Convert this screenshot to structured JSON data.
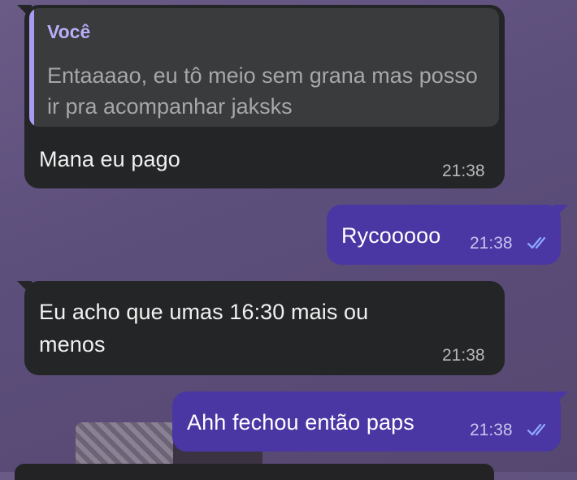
{
  "messages": [
    {
      "direction": "incoming",
      "reply": {
        "sender": "Você",
        "text": "Entaaaao, eu tô meio sem grana mas posso ir pra acompanhar jaksks"
      },
      "text": "Mana eu pago",
      "time": "21:38"
    },
    {
      "direction": "outgoing",
      "text": "Rycooooo",
      "time": "21:38",
      "status_icon": "double-check-icon"
    },
    {
      "direction": "incoming",
      "text": "Eu acho que umas 16:30 mais ou menos",
      "time": "21:38"
    },
    {
      "direction": "outgoing",
      "text": "Ahh fechou então paps",
      "time": "21:38",
      "status_icon": "double-check-icon"
    }
  ],
  "colors": {
    "incoming_bubble": "#242526",
    "outgoing_bubble": "#4a37a3",
    "reply_accent": "#a79cf2",
    "read_ticks": "#8fa8ff"
  }
}
